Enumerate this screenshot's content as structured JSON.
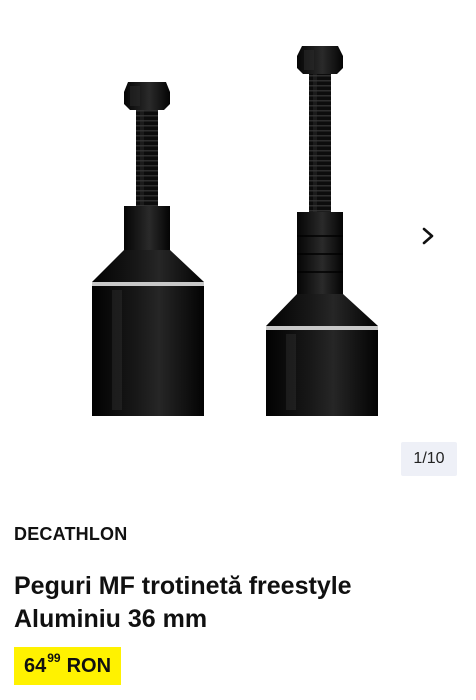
{
  "gallery": {
    "image_alt": "Peguri MF trotinetă freestyle Aluminiu 36 mm",
    "counter": "1/10",
    "next_icon": "chevron-right-icon"
  },
  "product": {
    "brand": "DECATHLON",
    "title": "Peguri MF trotinetă freestyle Aluminiu 36 mm",
    "price": {
      "integer": "64",
      "decimals": "99",
      "currency": "RON"
    }
  },
  "colors": {
    "price_highlight": "#fff200",
    "counter_bg": "#eef0f7"
  }
}
